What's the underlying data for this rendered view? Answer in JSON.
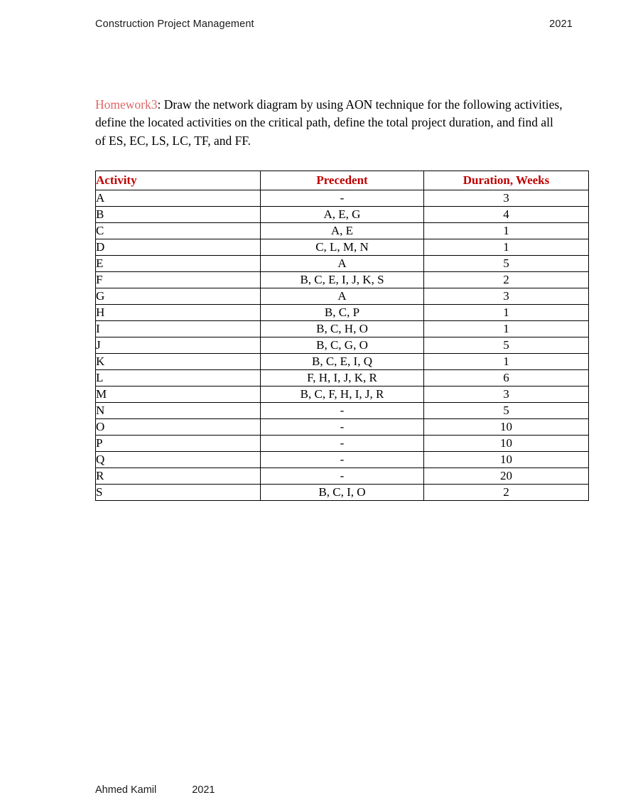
{
  "header": {
    "title": "Construction Project Management",
    "year": "2021"
  },
  "prompt": {
    "label": "Homework3",
    "colon": ":",
    "body": " Draw the network diagram by using AON technique for the following activities, define the located activities on the critical path, define the total project duration, and find all of ES, EC, LS, LC, TF, and FF."
  },
  "table": {
    "columns": [
      "Activity",
      "Precedent",
      "Duration, Weeks"
    ],
    "rows": [
      {
        "activity": "A",
        "precedent": "-",
        "duration": "3"
      },
      {
        "activity": "B",
        "precedent": "A, E, G",
        "duration": "4"
      },
      {
        "activity": "C",
        "precedent": "A, E",
        "duration": "1"
      },
      {
        "activity": "D",
        "precedent": "C, L, M, N",
        "duration": "1"
      },
      {
        "activity": "E",
        "precedent": "A",
        "duration": "5"
      },
      {
        "activity": "F",
        "precedent": "B, C, E, I, J, K, S",
        "duration": "2"
      },
      {
        "activity": "G",
        "precedent": "A",
        "duration": "3"
      },
      {
        "activity": "H",
        "precedent": "B, C, P",
        "duration": "1"
      },
      {
        "activity": "I",
        "precedent": "B, C, H, O",
        "duration": "1"
      },
      {
        "activity": "J",
        "precedent": "B, C, G, O",
        "duration": "5"
      },
      {
        "activity": "K",
        "precedent": "B, C, E, I, Q",
        "duration": "1"
      },
      {
        "activity": "L",
        "precedent": "F, H, I, J, K, R",
        "duration": "6"
      },
      {
        "activity": "M",
        "precedent": "B, C, F, H, I, J, R",
        "duration": "3"
      },
      {
        "activity": "N",
        "precedent": "-",
        "duration": "5"
      },
      {
        "activity": "O",
        "precedent": "-",
        "duration": "10"
      },
      {
        "activity": "P",
        "precedent": "-",
        "duration": "10"
      },
      {
        "activity": "Q",
        "precedent": "-",
        "duration": "10"
      },
      {
        "activity": "R",
        "precedent": "-",
        "duration": "20"
      },
      {
        "activity": "S",
        "precedent": "B, C, I, O",
        "duration": "2"
      }
    ]
  },
  "footer": {
    "name": "Ahmed Kamil",
    "year": "2021"
  },
  "colors": {
    "heading_red": "#c00000",
    "label_red": "#e06666",
    "text_black": "#000000",
    "rule_black": "#000000"
  }
}
